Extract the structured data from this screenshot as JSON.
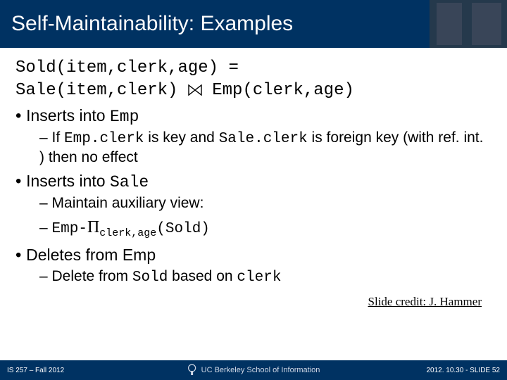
{
  "title": "Self-Maintainability: Examples",
  "eq": {
    "line1": "Sold(item,clerk,age) =",
    "line2_left": "Sale(item,clerk)",
    "line2_right": "Emp(clerk,age)"
  },
  "bullets": {
    "b1_pre": "Inserts into ",
    "b1_code": "Emp",
    "b1_sub_a": "If ",
    "b1_sub_b": "Emp.clerk",
    "b1_sub_c": " is key and ",
    "b1_sub_d": "Sale.clerk",
    "b1_sub_e": " is foreign key (with ref. int. ) then no effect",
    "b2_pre": "Inserts into ",
    "b2_code": "Sale",
    "b2_sub1": "Maintain auxiliary view:",
    "b2_sub2_a": "Emp-",
    "b2_sub2_pi": "Π",
    "b2_sub2_sub": "clerk,age",
    "b2_sub2_c": "(Sold)",
    "b3_text": "Deletes from Emp",
    "b3_sub_a": "Delete from ",
    "b3_sub_b": "Sold",
    "b3_sub_c": " based on ",
    "b3_sub_d": "clerk"
  },
  "credit": "Slide credit: J. Hammer",
  "footer": {
    "left": "IS 257 – Fall 2012",
    "center": "UC Berkeley School of Information",
    "right": "2012. 10.30 - SLIDE 52"
  }
}
